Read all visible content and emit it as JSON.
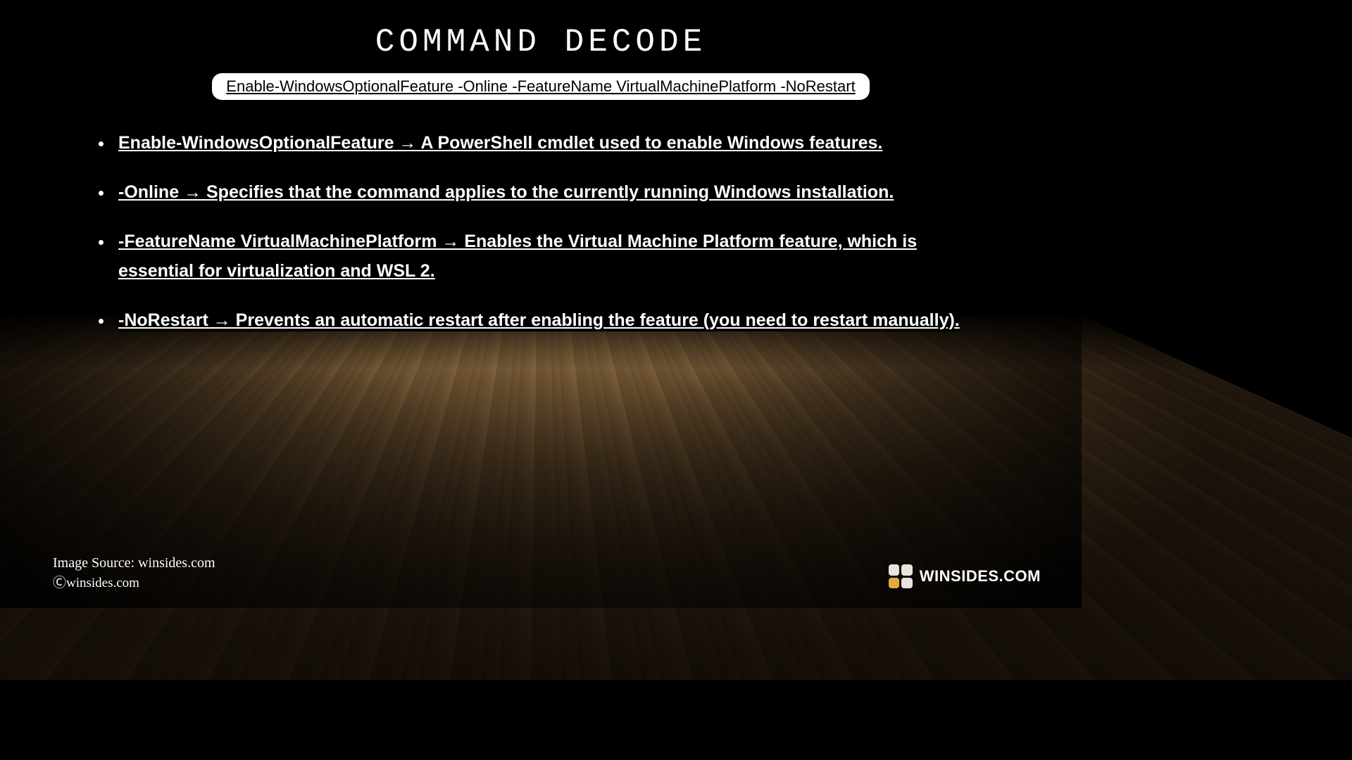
{
  "title": "COMMAND DECODE",
  "command": "Enable-WindowsOptionalFeature -Online -FeatureName VirtualMachinePlatform -NoRestart",
  "bullets": [
    "Enable-WindowsOptionalFeature → A PowerShell cmdlet used to enable Windows features.",
    "-Online → Specifies that the command applies to the currently running Windows installation.",
    "-FeatureName VirtualMachinePlatform → Enables the Virtual Machine Platform feature, which is essential for virtualization and WSL 2.",
    "-NoRestart → Prevents an automatic restart after enabling the feature (you need to restart manually)."
  ],
  "source": "Image Source: winsides.com",
  "copyright": "Ⓒwinsides.com",
  "brand": "WINSIDES.COM"
}
